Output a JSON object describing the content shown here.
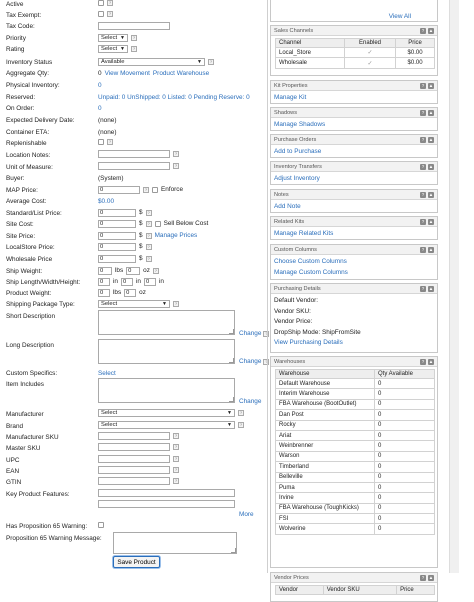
{
  "form": {
    "active_label": "Active",
    "tax_exempt_label": "Tax Exempt:",
    "tax_code_label": "Tax Code:",
    "priority_label": "Priority",
    "priority_value": "Select",
    "rating_label": "Rating",
    "rating_value": "Select",
    "inventory_status_label": "Inventory Status",
    "inventory_status_value": "Available",
    "aggregate_qty_label": "Aggregate Qty:",
    "aggregate_qty_value": "0",
    "view_movement_link": "View Movement",
    "product_warehouse_link": "Product Warehouse",
    "physical_inventory_label": "Physical Inventory:",
    "physical_inventory_value": "0",
    "reserved_label": "Reserved:",
    "reserved_value": "Unpaid: 0  UnShipped: 0  Listed: 0  Pending Reserve: 0",
    "on_order_label": "On Order:",
    "on_order_value": "0",
    "expected_delivery_label": "Expected Delivery Date:",
    "expected_delivery_value": "(none)",
    "container_eta_label": "Container ETA:",
    "container_eta_value": "(none)",
    "replenishable_label": "Replenishable",
    "location_notes_label": "Location Notes:",
    "unit_of_measure_label": "Unit of Measure:",
    "buyer_label": "Buyer:",
    "buyer_value": "(System)",
    "map_price_label": "MAP Price:",
    "map_price_value": "0",
    "enforce_label": "Enforce",
    "average_cost_label": "Average Cost:",
    "average_cost_value": "$0.00",
    "standard_list_price_label": "Standard/List Price:",
    "standard_list_price_value": "0",
    "site_cost_label": "Site Cost:",
    "site_cost_value": "0",
    "sell_below_cost_label": "Sell Below Cost",
    "site_price_label": "Site Price:",
    "site_price_value": "0",
    "manage_prices_link": "Manage Prices",
    "localstore_price_label": "LocalStore Price:",
    "localstore_price_value": "0",
    "wholesale_price_label": "Wholesale Price",
    "wholesale_price_value": "0",
    "ship_weight_label": "Ship Weight:",
    "ship_weight_lbs": "0",
    "ship_weight_oz": "0",
    "ship_dims_label": "Ship Length/Width/Height:",
    "ship_dims_l": "0",
    "ship_dims_w": "0",
    "ship_dims_h": "0",
    "product_weight_label": "Product Weight:",
    "product_weight_lbs": "0",
    "product_weight_oz": "0",
    "lbs_unit": "lbs",
    "oz_unit": "oz",
    "in_unit": "in",
    "dollar": "$",
    "shipping_package_label": "Shipping Package Type:",
    "shipping_package_value": "Select",
    "short_description_label": "Short Description",
    "long_description_label": "Long Description",
    "change_link": "Change",
    "custom_specifics_label": "Custom Specifics:",
    "custom_specifics_link": "Select",
    "item_includes_label": "Item Includes",
    "manufacturer_label": "Manufacturer",
    "manufacturer_value": "Select",
    "brand_label": "Brand",
    "brand_value": "Select",
    "manufacturer_sku_label": "Manufacturer SKU",
    "master_sku_label": "Master SKU",
    "upc_label": "UPC",
    "ean_label": "EAN",
    "gtin_label": "GTIN",
    "key_features_label": "Key Product Features:",
    "more_link": "More",
    "prop65_label": "Has Proposition 65 Warning:",
    "prop65_message_label": "Proposition 65 Warning Message:",
    "save_button": "Save Product"
  },
  "sidebar": {
    "view_all_link": "View All",
    "sales_channels": {
      "title": "Sales Channels",
      "columns": [
        "Channel",
        "Enabled",
        "Price"
      ],
      "rows": [
        {
          "channel": "Local_Store",
          "price": "$0.00"
        },
        {
          "channel": "Wholesale",
          "price": "$0.00"
        }
      ]
    },
    "kit_properties": {
      "title": "Kit Properties",
      "link": "Manage Kit"
    },
    "shadows": {
      "title": "Shadows",
      "link": "Manage Shadows"
    },
    "purchase_orders": {
      "title": "Purchase Orders",
      "link": "Add to Purchase"
    },
    "inventory_transfers": {
      "title": "Inventory Transfers",
      "link": "Adjust Inventory"
    },
    "notes": {
      "title": "Notes",
      "link": "Add Note"
    },
    "related_kits": {
      "title": "Related Kits",
      "link": "Manage Related Kits"
    },
    "custom_columns": {
      "title": "Custom Columns",
      "link1": "Choose Custom Columns",
      "link2": "Manage Custom Columns"
    },
    "purchasing_details": {
      "title": "Purchasing Details",
      "default_vendor": "Default Vendor:",
      "vendor_sku": "Vendor SKU:",
      "vendor_price": "Vendor Price:",
      "dropship_mode": "DropShip Mode: ShipFromSite",
      "link": "View Purchasing Details"
    },
    "warehouses": {
      "title": "Warehouses",
      "columns": [
        "Warehouse",
        "Qty Available"
      ],
      "rows": [
        {
          "name": "Default Warehouse",
          "qty": "0"
        },
        {
          "name": "Interim Warehouse",
          "qty": "0"
        },
        {
          "name": "FBA Warehouse (BootOutlet)",
          "qty": "0"
        },
        {
          "name": "Dan Post",
          "qty": "0"
        },
        {
          "name": "Rocky",
          "qty": "0"
        },
        {
          "name": "Ariat",
          "qty": "0"
        },
        {
          "name": "Weinbrenner",
          "qty": "0"
        },
        {
          "name": "Warson",
          "qty": "0"
        },
        {
          "name": "Timberland",
          "qty": "0"
        },
        {
          "name": "Belleville",
          "qty": "0"
        },
        {
          "name": "Puma",
          "qty": "0"
        },
        {
          "name": "Irvine",
          "qty": "0"
        },
        {
          "name": "FBA Warehouse (ToughKicks)",
          "qty": "0"
        },
        {
          "name": "FSI",
          "qty": "0"
        },
        {
          "name": "Wolverine",
          "qty": "0"
        }
      ]
    },
    "vendor_prices": {
      "title": "Vendor Prices",
      "columns": [
        "Vendor",
        "Vendor SKU",
        "Price"
      ]
    }
  }
}
